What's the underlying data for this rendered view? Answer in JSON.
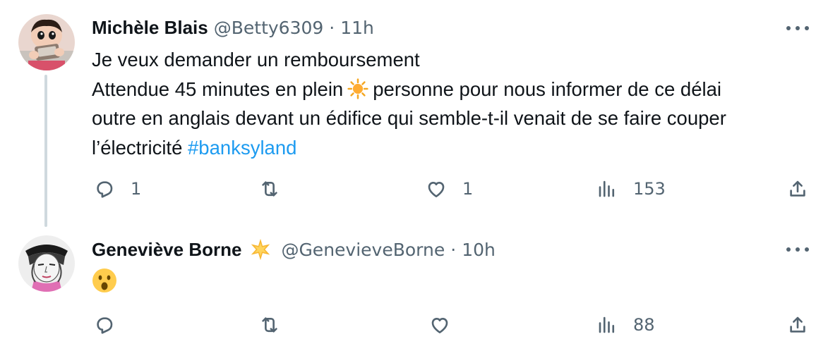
{
  "tweets": [
    {
      "author": {
        "name": "Michèle Blais",
        "handle": "@Betty6309",
        "time": "11h"
      },
      "separator": "·",
      "text_lines": [
        "Je veux demander un remboursement",
        "Attendue 45 minutes en plein",
        "personne pour nous informer de ce délai",
        "outre en anglais devant un édifice qui semble-t-il venait de se faire couper",
        "l’électricité"
      ],
      "hashtag": "#banksyland",
      "emoji": "sun",
      "actions": {
        "replies": "1",
        "retweets": "",
        "likes": "1",
        "views": "153"
      }
    },
    {
      "author": {
        "name": "Geneviève Borne",
        "handle": "@GenevieveBorne",
        "time": "10h"
      },
      "separator": "·",
      "badge": "star",
      "emoji": "face-with-open-mouth",
      "actions": {
        "replies": "",
        "retweets": "",
        "likes": "",
        "views": "88"
      }
    }
  ],
  "colors": {
    "text": "#0f1419",
    "secondary": "#536471",
    "link": "#1d9bf0",
    "thread_line": "#cfd9de"
  }
}
